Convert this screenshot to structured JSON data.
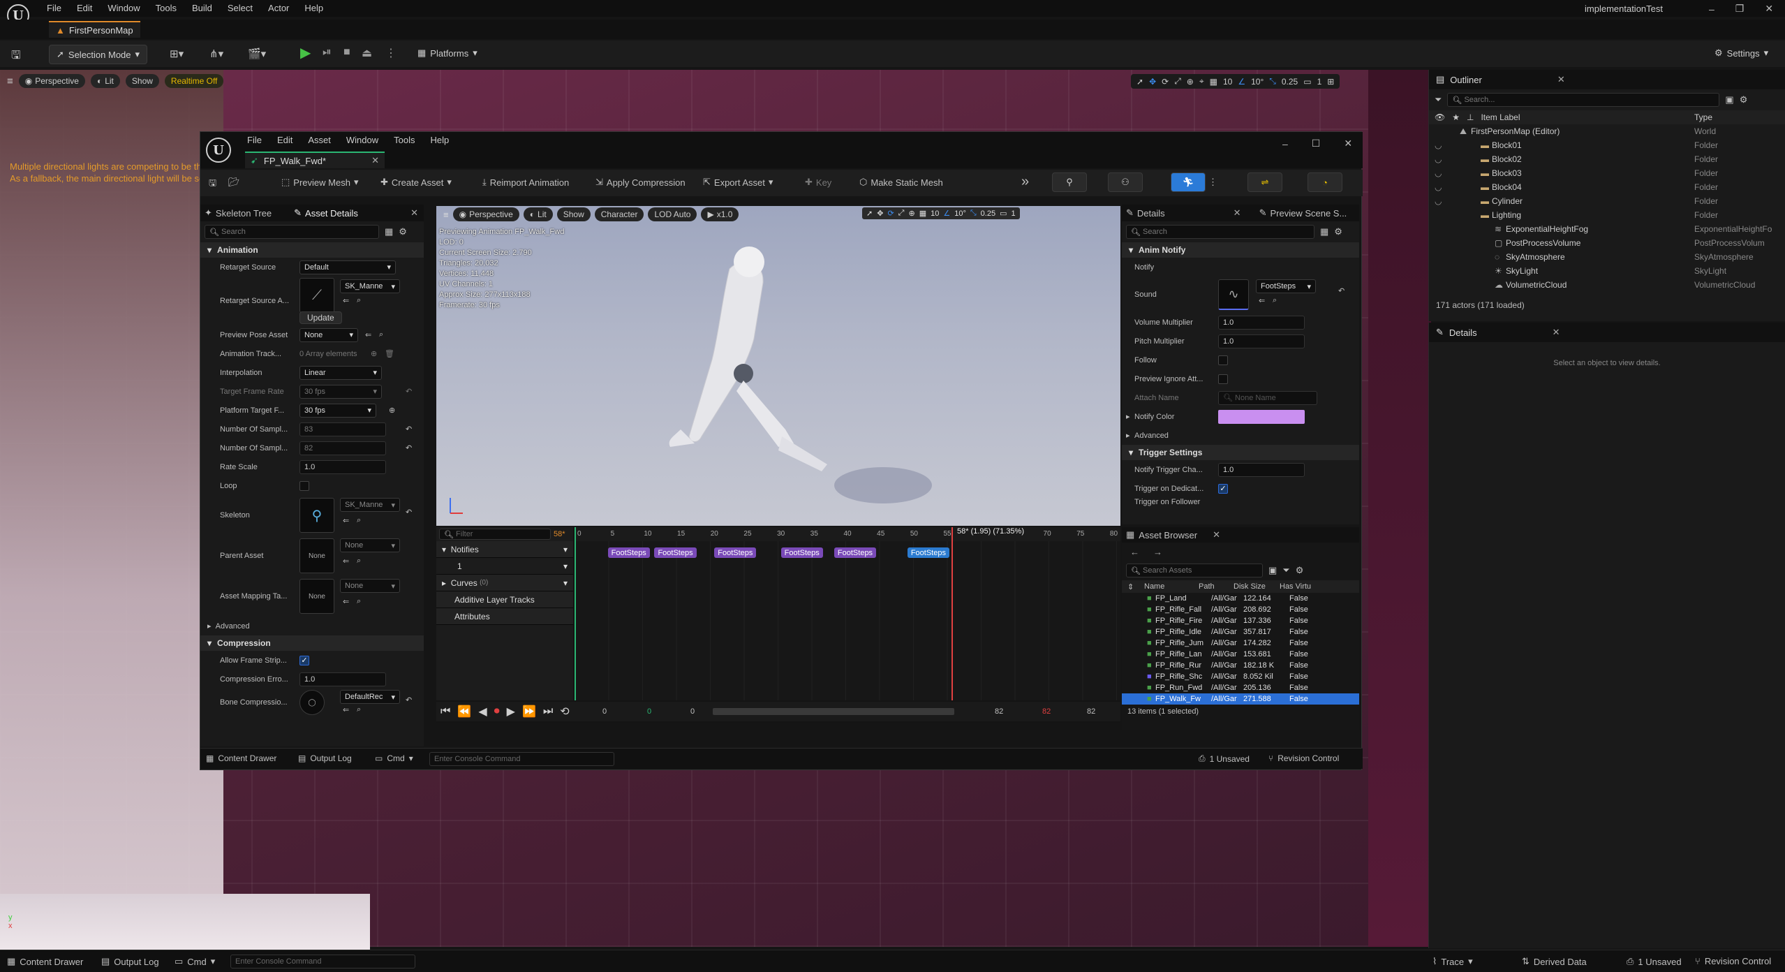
{
  "app": {
    "menu": [
      "File",
      "Edit",
      "Window",
      "Tools",
      "Build",
      "Select",
      "Actor",
      "Help"
    ],
    "project": "implementationTest",
    "map_tab": "FirstPersonMap"
  },
  "main_toolbar": {
    "selection_mode": "Selection Mode",
    "platforms": "Platforms",
    "settings": "Settings"
  },
  "viewport": {
    "perspective": "Perspective",
    "lit": "Lit",
    "show": "Show",
    "realtime": "Realtime Off",
    "warning": [
      "Multiple directional lights are competing to be th",
      "As a fallback, the main directional light will be se"
    ],
    "grid": "10",
    "angle": "10°",
    "scale": "0.25",
    "cam": "1"
  },
  "outliner": {
    "title": "Outliner",
    "search_placeholder": "Search...",
    "col_label": "Item Label",
    "col_type": "Type",
    "items": [
      {
        "label": "FirstPersonMap (Editor)",
        "type": "World"
      },
      {
        "label": "Block01",
        "type": "Folder"
      },
      {
        "label": "Block02",
        "type": "Folder"
      },
      {
        "label": "Block03",
        "type": "Folder"
      },
      {
        "label": "Block04",
        "type": "Folder"
      },
      {
        "label": "Cylinder",
        "type": "Folder"
      },
      {
        "label": "Lighting",
        "type": "Folder"
      },
      {
        "label": "ExponentialHeightFog",
        "type": "ExponentialHeightFo"
      },
      {
        "label": "PostProcessVolume",
        "type": "PostProcessVolum"
      },
      {
        "label": "SkyAtmosphere",
        "type": "SkyAtmosphere"
      },
      {
        "label": "SkyLight",
        "type": "SkyLight"
      },
      {
        "label": "VolumetricCloud",
        "type": "VolumetricCloud"
      }
    ],
    "count": "171 actors (171 loaded)"
  },
  "details_main": {
    "title": "Details",
    "empty": "Select an object to view details."
  },
  "anim_editor": {
    "menu": [
      "File",
      "Edit",
      "Asset",
      "Window",
      "Tools",
      "Help"
    ],
    "tab": "FP_Walk_Fwd*",
    "toolbar": {
      "preview_mesh": "Preview Mesh",
      "create_asset": "Create Asset",
      "reimport": "Reimport Animation",
      "apply_compression": "Apply Compression",
      "export_asset": "Export Asset",
      "key": "Key",
      "make_static": "Make Static Mesh"
    },
    "left_tabs": {
      "skeleton_tree": "Skeleton Tree",
      "asset_details": "Asset Details"
    },
    "search_placeholder": "Search",
    "sections": {
      "animation": "Animation",
      "advanced": "Advanced",
      "compression": "Compression"
    },
    "props": {
      "retarget_source": {
        "label": "Retarget Source",
        "value": "Default"
      },
      "retarget_source_asset": {
        "label": "Retarget Source A...",
        "value": "SK_Manne",
        "btn": "Update"
      },
      "preview_pose": {
        "label": "Preview Pose Asset",
        "value": "None"
      },
      "anim_track": {
        "label": "Animation Track...",
        "value": "0 Array elements"
      },
      "interpolation": {
        "label": "Interpolation",
        "value": "Linear"
      },
      "target_frame_rate": {
        "label": "Target Frame Rate",
        "value": "30 fps"
      },
      "platform_target": {
        "label": "Platform Target F...",
        "value": "30 fps"
      },
      "num_samples1": {
        "label": "Number Of Sampl...",
        "value": "83"
      },
      "num_samples2": {
        "label": "Number Of Sampl...",
        "value": "82"
      },
      "rate_scale": {
        "label": "Rate Scale",
        "value": "1.0"
      },
      "loop": {
        "label": "Loop"
      },
      "skeleton": {
        "label": "Skeleton",
        "value": "SK_Manne"
      },
      "parent_asset": {
        "label": "Parent Asset",
        "value": "None",
        "thumb": "None"
      },
      "asset_mapping": {
        "label": "Asset Mapping Ta...",
        "value": "None",
        "thumb": "None"
      },
      "allow_frame_strip": {
        "label": "Allow Frame Strip..."
      },
      "compression_error": {
        "label": "Compression Erro...",
        "value": "1.0"
      },
      "bone_compression": {
        "label": "Bone Compressio...",
        "value": "DefaultRec"
      }
    },
    "vp": {
      "perspective": "Perspective",
      "lit": "Lit",
      "show": "Show",
      "character": "Character",
      "lod": "LOD Auto",
      "speed": "x1.0",
      "grid": "10",
      "angle": "10°",
      "scale": "0.25",
      "cam": "1",
      "overlay": [
        "Previewing Animation FP_Walk_Fwd",
        "LOD: 0",
        "Current Screen Size: 2.790",
        "Triangles: 20,032",
        "Vertices: 11,448",
        "UV Channels: 1",
        "Approx Size: 277x113x188",
        "Framerate: 30 fps"
      ]
    },
    "timeline": {
      "filter_placeholder": "Filter",
      "frame": "58*",
      "marker": "58* (1.95) (71.35%)",
      "tracks": {
        "notifies": "Notifies",
        "notify_track": "1",
        "curves": "Curves",
        "curves_count": "(0)",
        "additive": "Additive Layer Tracks",
        "attributes": "Attributes"
      },
      "ticks": [
        "0",
        "5",
        "10",
        "15",
        "20",
        "25",
        "30",
        "35",
        "40",
        "45",
        "50",
        "55",
        "60",
        "65",
        "70",
        "75",
        "80"
      ],
      "notify_label": "FootSteps",
      "frames": {
        "start": "0",
        "start_green": "0",
        "current": "0",
        "end": "82",
        "end_red": "82",
        "end2": "82"
      }
    },
    "details": {
      "title": "Details",
      "preview_scene": "Preview Scene S...",
      "search_placeholder": "Search",
      "anim_notify": "Anim Notify",
      "notify": "Notify",
      "sound": "Sound",
      "sound_value": "FootSteps",
      "volume": {
        "label": "Volume Multiplier",
        "value": "1.0"
      },
      "pitch": {
        "label": "Pitch Multiplier",
        "value": "1.0"
      },
      "follow": "Follow",
      "preview_ignore": "Preview Ignore Att...",
      "attach": {
        "label": "Attach Name",
        "value": "None Name"
      },
      "notify_color": "Notify Color",
      "advanced": "Advanced",
      "trigger_settings": "Trigger Settings",
      "trigger_chance": {
        "label": "Notify Trigger Cha...",
        "value": "1.0"
      },
      "trigger_dedicated": "Trigger on Dedicat...",
      "trigger_follower": "Trigger on Follower",
      "color_hex": "#c98ff0"
    },
    "asset_browser": {
      "title": "Asset Browser",
      "search_placeholder": "Search Assets",
      "cols": [
        "Name",
        "Path",
        "Disk Size",
        "Has Virtu"
      ],
      "rows": [
        {
          "name": "FP_Land",
          "path": "/All/Gar",
          "size": "122.164",
          "virt": "False"
        },
        {
          "name": "FP_Rifle_Fall",
          "path": "/All/Gar",
          "size": "208.692",
          "virt": "False"
        },
        {
          "name": "FP_Rifle_Fire",
          "path": "/All/Gar",
          "size": "137.336",
          "virt": "False"
        },
        {
          "name": "FP_Rifle_Idle",
          "path": "/All/Gar",
          "size": "357.817",
          "virt": "False"
        },
        {
          "name": "FP_Rifle_Jum",
          "path": "/All/Gar",
          "size": "174.282",
          "virt": "False"
        },
        {
          "name": "FP_Rifle_Lan",
          "path": "/All/Gar",
          "size": "153.681",
          "virt": "False"
        },
        {
          "name": "FP_Rifle_Rur",
          "path": "/All/Gar",
          "size": "182.18 K",
          "virt": "False"
        },
        {
          "name": "FP_Rifle_Shc",
          "path": "/All/Gar",
          "size": "8.052 Kil",
          "virt": "False"
        },
        {
          "name": "FP_Run_Fwd",
          "path": "/All/Gar",
          "size": "205.136",
          "virt": "False"
        },
        {
          "name": "FP_Walk_Fw",
          "path": "/All/Gar",
          "size": "271.588",
          "virt": "False"
        }
      ],
      "count": "13 items (1 selected)"
    },
    "bottom": {
      "content_drawer": "Content Drawer",
      "output_log": "Output Log",
      "cmd": "Cmd",
      "console_placeholder": "Enter Console Command",
      "unsaved": "1 Unsaved",
      "revision": "Revision Control"
    }
  },
  "status": {
    "content_drawer": "Content Drawer",
    "output_log": "Output Log",
    "cmd": "Cmd",
    "console_placeholder": "Enter Console Command",
    "trace": "Trace",
    "derived_data": "Derived Data",
    "unsaved": "1 Unsaved",
    "revision": "Revision Control"
  }
}
